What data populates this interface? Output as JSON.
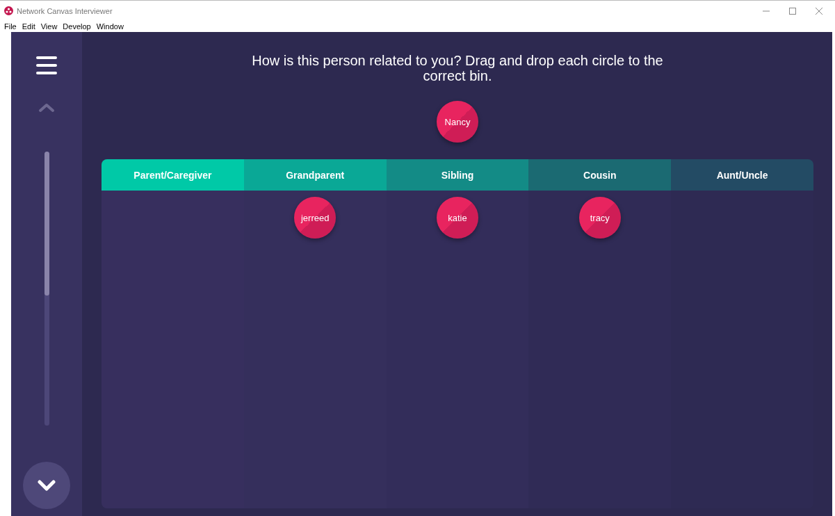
{
  "window": {
    "title": "Network Canvas Interviewer"
  },
  "menu": [
    "File",
    "Edit",
    "View",
    "Develop",
    "Window"
  ],
  "sidebar": {
    "progress": {
      "level": 0.525
    }
  },
  "prompt": {
    "text": "How is this person related to you? Drag and drop each circle to the correct bin."
  },
  "prompt_node": {
    "label": "Nancy"
  },
  "bins": [
    {
      "label": "Parent/Caregiver",
      "color": "#00c9a7"
    },
    {
      "label": "Grandparent",
      "color": "#0aa896",
      "nodes": [
        {
          "label": "jerreed"
        }
      ]
    },
    {
      "label": "Sibling",
      "color": "#138b86",
      "nodes": [
        {
          "label": "katie"
        }
      ]
    },
    {
      "label": "Cousin",
      "color": "#1b6a72",
      "nodes": [
        {
          "label": "tracy"
        }
      ]
    },
    {
      "label": "Aunt/Uncle",
      "color": "#234b64"
    }
  ]
}
